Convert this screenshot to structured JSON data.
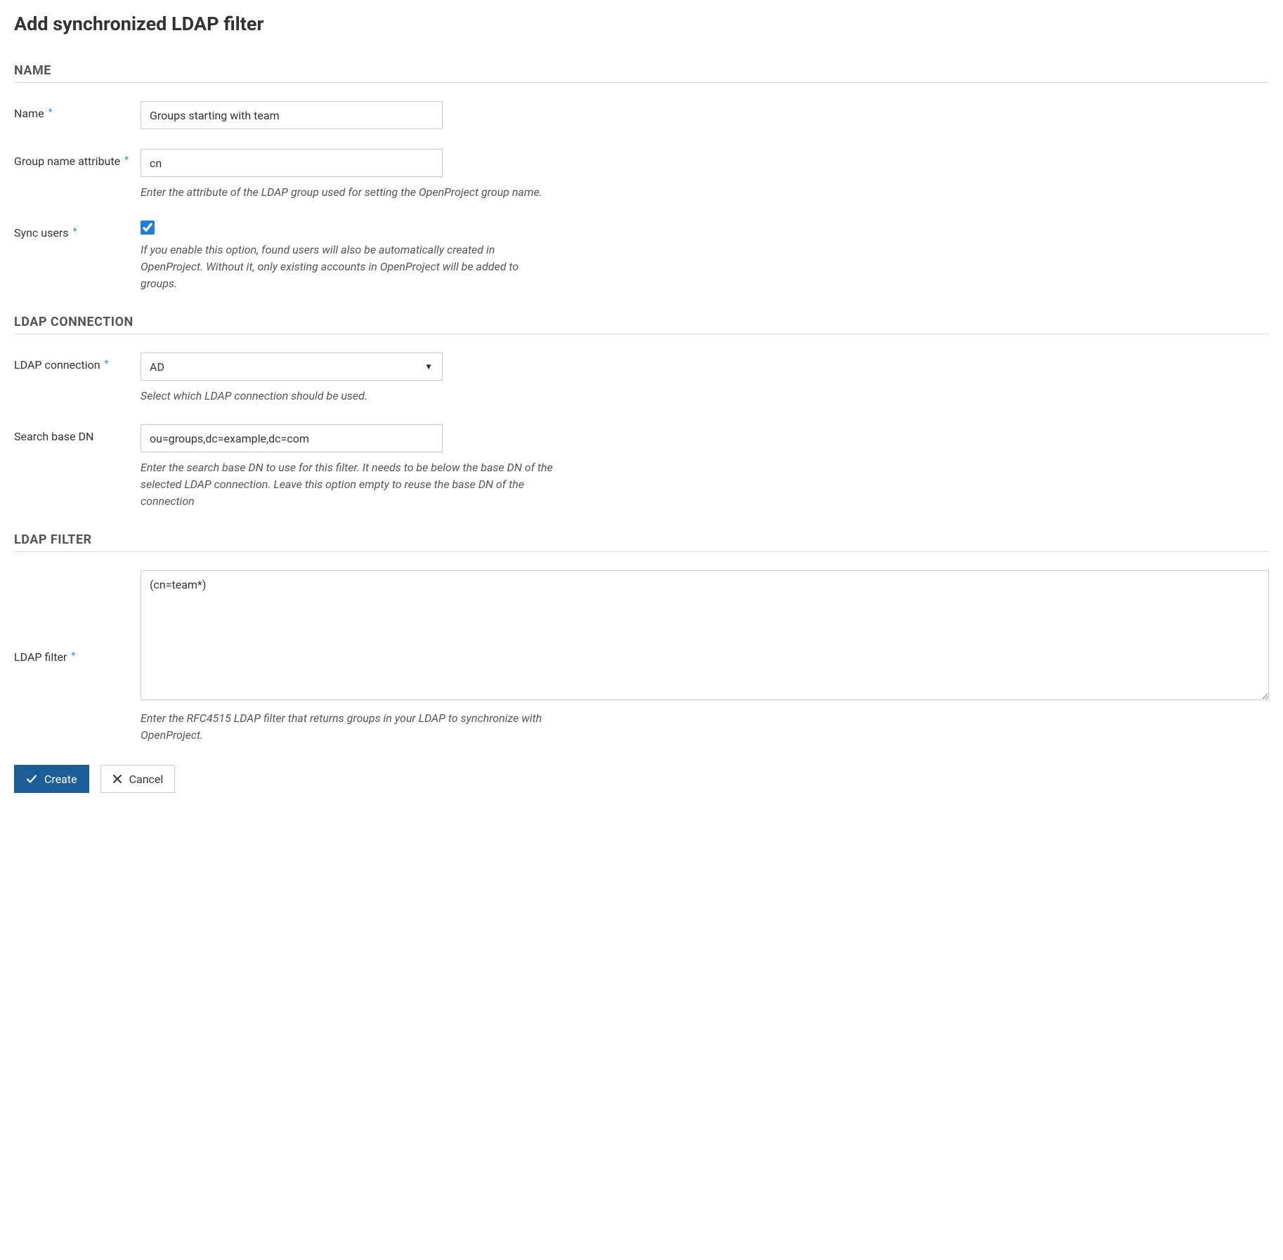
{
  "page": {
    "title": "Add synchronized LDAP filter"
  },
  "sections": {
    "name": {
      "header": "NAME",
      "fields": {
        "name": {
          "label": "Name",
          "value": "Groups starting with team"
        },
        "group_name_attribute": {
          "label": "Group name attribute",
          "value": "cn",
          "help": "Enter the attribute of the LDAP group used for setting the OpenProject group name."
        },
        "sync_users": {
          "label": "Sync users",
          "checked": true,
          "help": "If you enable this option, found users will also be automatically created in OpenProject. Without it, only existing accounts in OpenProject will be added to groups."
        }
      }
    },
    "ldap_connection": {
      "header": "LDAP CONNECTION",
      "fields": {
        "connection": {
          "label": "LDAP connection",
          "value": "AD",
          "help": "Select which LDAP connection should be used."
        },
        "search_base_dn": {
          "label": "Search base DN",
          "value": "ou=groups,dc=example,dc=com",
          "help": "Enter the search base DN to use for this filter. It needs to be below the base DN of the selected LDAP connection. Leave this option empty to reuse the base DN of the connection"
        }
      }
    },
    "ldap_filter": {
      "header": "LDAP FILTER",
      "fields": {
        "filter": {
          "label": "LDAP filter",
          "value": "(cn=team*)",
          "help": "Enter the RFC4515 LDAP filter that returns groups in your LDAP to synchronize with OpenProject."
        }
      }
    }
  },
  "buttons": {
    "create": "Create",
    "cancel": "Cancel"
  }
}
